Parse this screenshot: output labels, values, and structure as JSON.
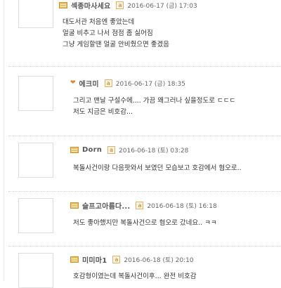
{
  "comments": [
    {
      "nickname": "섹종마사세요",
      "date": "2016-06-17 (금) 17:03",
      "text": "대도서관 처음엔 좋았는데\n얼굴 비추고 나서 점점 좀 싫어짐\n그냥 게임할땐 얼굴 안비췄으면 좋겠음"
    },
    {
      "nickname": "에크미",
      "date": "2016-06-17 (금) 18:35",
      "text": "그리고 맨날 구설수에.... 가끔 왜그러나 싶을정도로 ㄷㄷㄷ\n저도 지금은 비호감..."
    },
    {
      "nickname": "Dorn",
      "date": "2016-06-18 (토) 03:28",
      "text": "복돌사건이랑 다음팟와서 보였던 모습보고 호감에서 혐오로.."
    },
    {
      "nickname": "슬프고아름다...",
      "date": "2016-06-18 (토) 16:18",
      "text": "저도 좋아했지만 복돌사건으로 혐오로 갔네요.. ㅋㅋ"
    },
    {
      "nickname": "미미마1",
      "date": "2016-06-18 (토) 20:10",
      "text": "호감형이였는데 복돌사건이후... 완전 비호감"
    }
  ]
}
